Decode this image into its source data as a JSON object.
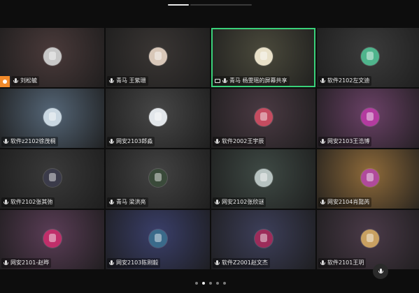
{
  "tiles": [
    {
      "label": "刘松毓",
      "bg": "#4a3a3a",
      "avatar": "#c7c7c7",
      "host": true
    },
    {
      "label": "青马 王紫珊",
      "bg": "#3a3634",
      "avatar": "#d8c7b8"
    },
    {
      "label": "青马 杨雯瑶的屏幕共享",
      "bg": "#4b4a3c",
      "avatar": "#e8e0c8",
      "screen": true,
      "active": true
    },
    {
      "label": "软件2102左文迪",
      "bg": "#3b3b3b",
      "avatar": "#4fb48c"
    },
    {
      "label": "软件z2102徐茂桐",
      "bg": "#556677",
      "avatar": "#c9d7e1"
    },
    {
      "label": "网安2103郎淼",
      "bg": "#474747",
      "avatar": "#e2e6ea"
    },
    {
      "label": "软件2002王宇辰",
      "bg": "#4a3a43",
      "avatar": "#c44c60"
    },
    {
      "label": "网安2103王浩博",
      "bg": "#6a4166",
      "avatar": "#b33b9f"
    },
    {
      "label": "软件2102张其弛",
      "bg": "#3a3a3a",
      "avatar": "#3b3b4a"
    },
    {
      "label": "青马 梁洪亮",
      "bg": "#434343",
      "avatar": "#3a4a3a"
    },
    {
      "label": "网安2102张欣谜",
      "bg": "#3f4a45",
      "avatar": "#b6c2c0"
    },
    {
      "label": "网安2104肖懿芮",
      "bg": "#8e6a3a",
      "avatar": "#b04a9b"
    },
    {
      "label": "网安2101-赵晔",
      "bg": "#5a3d56",
      "avatar": "#c02e6a"
    },
    {
      "label": "网安2103陈刚毅",
      "bg": "#3a3f6a",
      "avatar": "#3a6a8a"
    },
    {
      "label": "软件Z2001赵文杰",
      "bg": "#3d3f5a",
      "avatar": "#9c2c5a"
    },
    {
      "label": "软件2101王玥",
      "bg": "#4a3a48",
      "avatar": "#c8a061"
    }
  ],
  "pager": {
    "dots": 5,
    "active_index": 1
  }
}
